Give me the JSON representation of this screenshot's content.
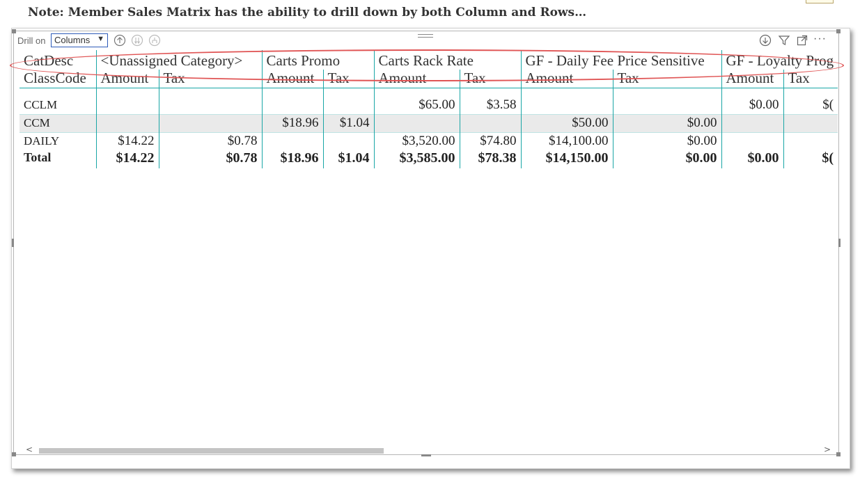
{
  "note": "Note: Member Sales Matrix has the ability to drill down by both Column and Rows…",
  "toolbar": {
    "drill_on_label": "Drill on",
    "drill_select_value": "Columns",
    "drill_select_arrow": "▼",
    "more_label": "···"
  },
  "matrix": {
    "cat_header": "CatDesc",
    "class_header": "ClassCode",
    "categories": [
      "<Unassigned Category>",
      "Carts Promo",
      "Carts Rack Rate",
      "GF - Daily Fee Price Sensitive",
      "GF - Loyalty Prog"
    ],
    "measures": [
      "Amount",
      "Tax",
      "Amount",
      "Tax",
      "Amount",
      "Tax",
      "Amount",
      "Tax",
      "Amount",
      "Tax"
    ],
    "rows": [
      {
        "label": "CCLM",
        "cells": [
          "",
          "",
          "",
          "",
          "$65.00",
          "$3.58",
          "",
          "",
          "$0.00",
          "$("
        ]
      },
      {
        "label": "CCM",
        "cells": [
          "",
          "",
          "$18.96",
          "$1.04",
          "",
          "",
          "$50.00",
          "$0.00",
          "",
          ""
        ]
      },
      {
        "label": "DAILY",
        "cells": [
          "$14.22",
          "$0.78",
          "",
          "",
          "$3,520.00",
          "$74.80",
          "$14,100.00",
          "$0.00",
          "",
          ""
        ]
      }
    ],
    "total": {
      "label": "Total",
      "cells": [
        "$14.22",
        "$0.78",
        "$18.96",
        "$1.04",
        "$3,585.00",
        "$78.38",
        "$14,150.00",
        "$0.00",
        "$0.00",
        "$("
      ]
    }
  },
  "scroll": {
    "left": "<",
    "right": ">"
  },
  "colors": {
    "grid": "#19a6a6",
    "highlight": "#e05555",
    "accent": "#2d5bb9"
  }
}
